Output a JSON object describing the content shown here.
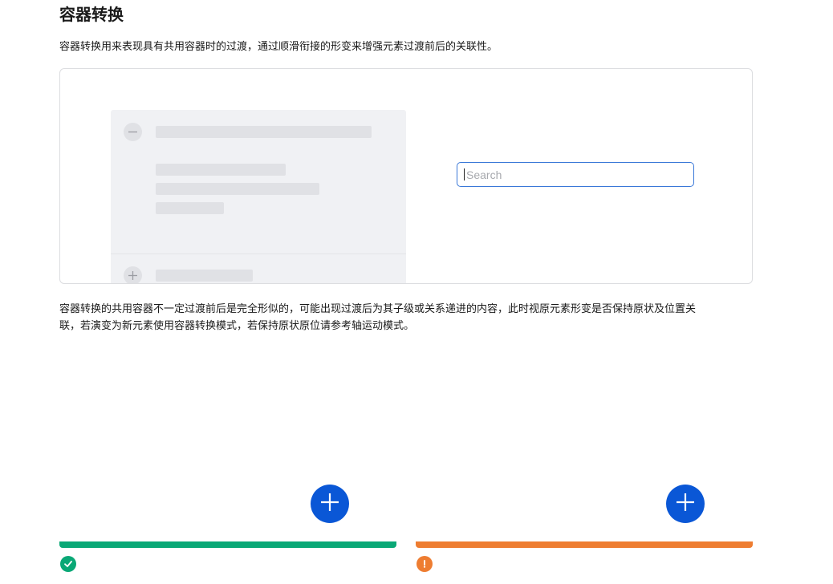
{
  "section": {
    "title": "容器转换",
    "intro": "容器转换用来表现具有共用容器时的过渡，通过顺滑衔接的形变来增强元素过渡前后的关联性。",
    "description_line1": "容器转换的共用容器不一定过渡前后是完全形似的，可能出现过渡后为其子级或关系递进的内容，此时视原元素形变是否保持原状及位置关",
    "description_line2": "联，若演变为新元素使用容器转换模式，若保持原状原位请参考轴运动模式。"
  },
  "demo": {
    "search_placeholder": "Search",
    "collapse_icon": "minus-icon",
    "expand_icon": "plus-icon"
  },
  "examples": {
    "good": {
      "status": "success",
      "bar_color": "#0aa876",
      "icon": "check-circle-icon",
      "button_icon": "plus-icon"
    },
    "bad": {
      "status": "warning",
      "bar_color": "#ee7d31",
      "icon": "exclamation-circle-icon",
      "button_icon": "plus-icon"
    }
  },
  "colors": {
    "accent": "#0a57d6",
    "search_border": "#3a78d8",
    "success": "#0aa876",
    "warning": "#ee7d31"
  }
}
